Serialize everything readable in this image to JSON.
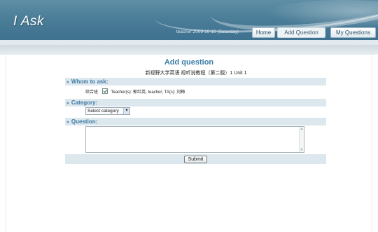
{
  "header": {
    "logo": "I Ask",
    "user_info": "teacher   2009-10-10 (Saturday)",
    "nav": {
      "home": "Home",
      "add_question": "Add Question",
      "my_questions": "My Questions"
    }
  },
  "form": {
    "title": "Add question",
    "course": "新视野大学英语 视听说教程（第二版）1  Unit 1",
    "sections": {
      "whom": "Whom to ask:",
      "category": "Category:",
      "question": "Question:"
    },
    "whom": {
      "group": "综合班",
      "checked": true,
      "recipients": "Teacher(s): 郭红英, teacher;    TA(s): 刘梅"
    },
    "category": {
      "selected": "Select category"
    },
    "question_value": "",
    "submit_label": "Submit"
  },
  "colors": {
    "header": "#4b7e98",
    "accent": "#3b7ca6",
    "section_bg": "#dde7ee"
  },
  "icons": {
    "bullet": "»",
    "dropdown": "chevron-down-icon",
    "check": "check-icon"
  }
}
